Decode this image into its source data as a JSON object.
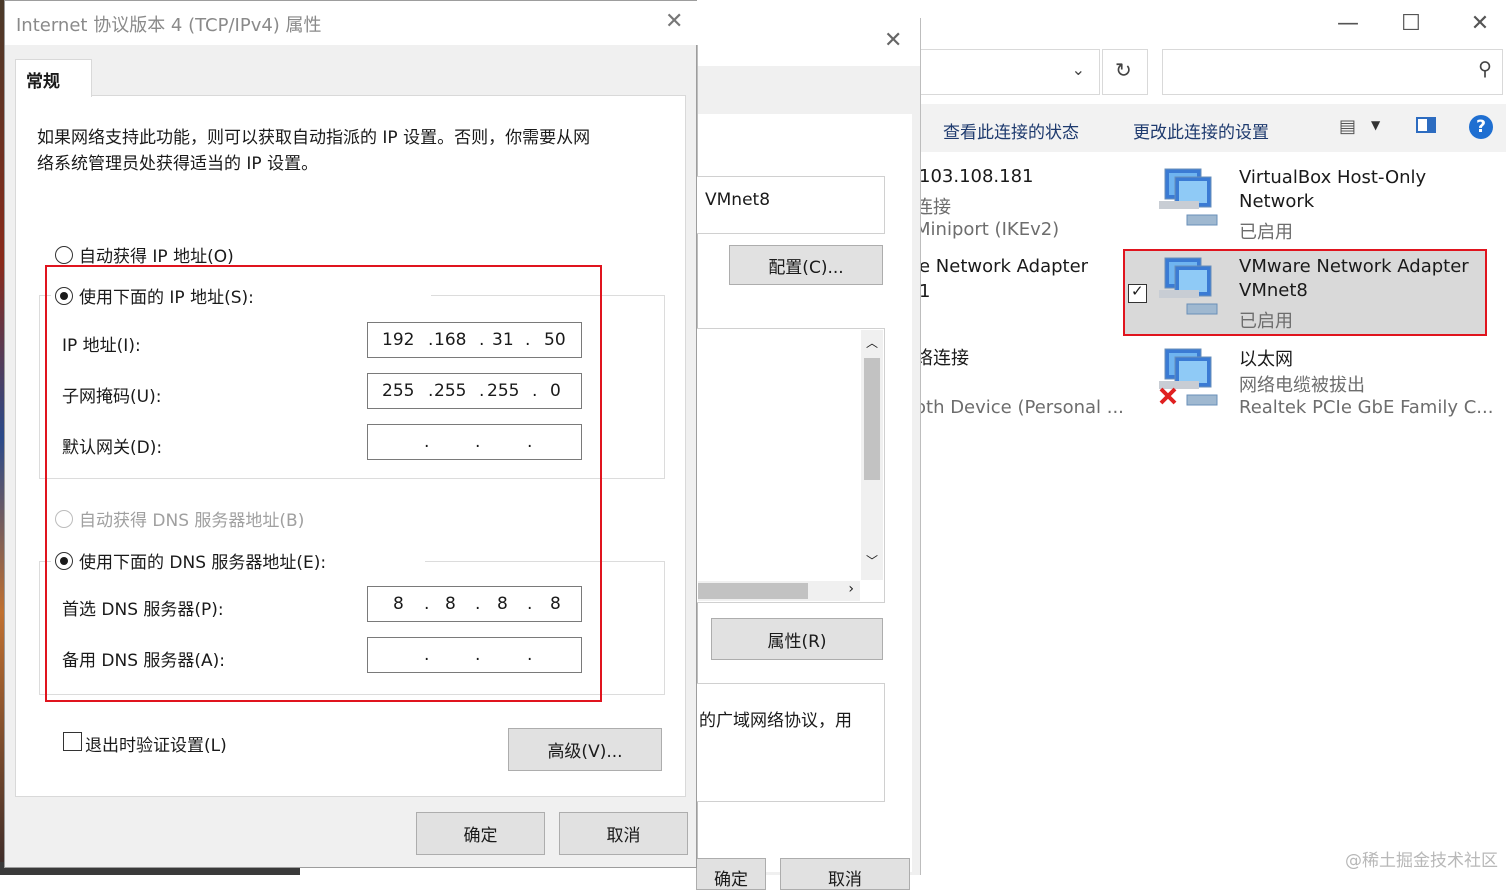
{
  "dialog": {
    "title": "Internet 协议版本 4 (TCP/IPv4) 属性",
    "tab": "常规",
    "description_line1": "如果网络支持此功能，则可以获取自动指派的 IP 设置。否则，你需要从网",
    "description_line2": "络系统管理员处获得适当的 IP 设置。",
    "auto_ip": "自动获得 IP 地址(O)",
    "use_ip": "使用下面的 IP 地址(S):",
    "ip_label": "IP 地址(I):",
    "ip_value": [
      "192",
      "168",
      "31",
      "50"
    ],
    "mask_label": "子网掩码(U):",
    "mask_value": [
      "255",
      "255",
      "255",
      "0"
    ],
    "gateway_label": "默认网关(D):",
    "gateway_value": [
      "",
      "",
      "",
      ""
    ],
    "auto_dns": "自动获得 DNS 服务器地址(B)",
    "use_dns": "使用下面的 DNS 服务器地址(E):",
    "dns1_label": "首选 DNS 服务器(P):",
    "dns1_value": [
      "8",
      "8",
      "8",
      "8"
    ],
    "dns2_label": "备用 DNS 服务器(A):",
    "dns2_value": [
      "",
      "",
      "",
      ""
    ],
    "validate": "退出时验证设置(L)",
    "advanced": "高级(V)...",
    "ok": "确定",
    "cancel": "取消"
  },
  "middle_dialog": {
    "adapter_name": "VMnet8",
    "configure": "配置(C)...",
    "properties": "属性(R)",
    "description": "的广域网络协议，用",
    "ok": "确定",
    "cancel": "取消"
  },
  "explorer": {
    "cmd_view_status": "查看此连接的状态",
    "cmd_change_settings": "更改此连接的设置",
    "left_items": [
      "103.108.181",
      "连接",
      "Miniport (IKEv2)",
      "e Network Adapter",
      "1",
      "络连接",
      "oth Device (Personal ..."
    ],
    "items": [
      {
        "name1": "VirtualBox Host-Only",
        "name2": "Network",
        "status": "已启用"
      },
      {
        "name1": "VMware Network Adapter",
        "name2": "VMnet8",
        "status": "已启用"
      },
      {
        "name1": "以太网",
        "name2": "网络电缆被拔出",
        "status": "Realtek PCIe GbE Family C..."
      }
    ]
  },
  "watermark": "@稀土掘金技术社区",
  "colors": {
    "highlight_red": "#e0141e",
    "link_blue": "#1e3a6e"
  }
}
